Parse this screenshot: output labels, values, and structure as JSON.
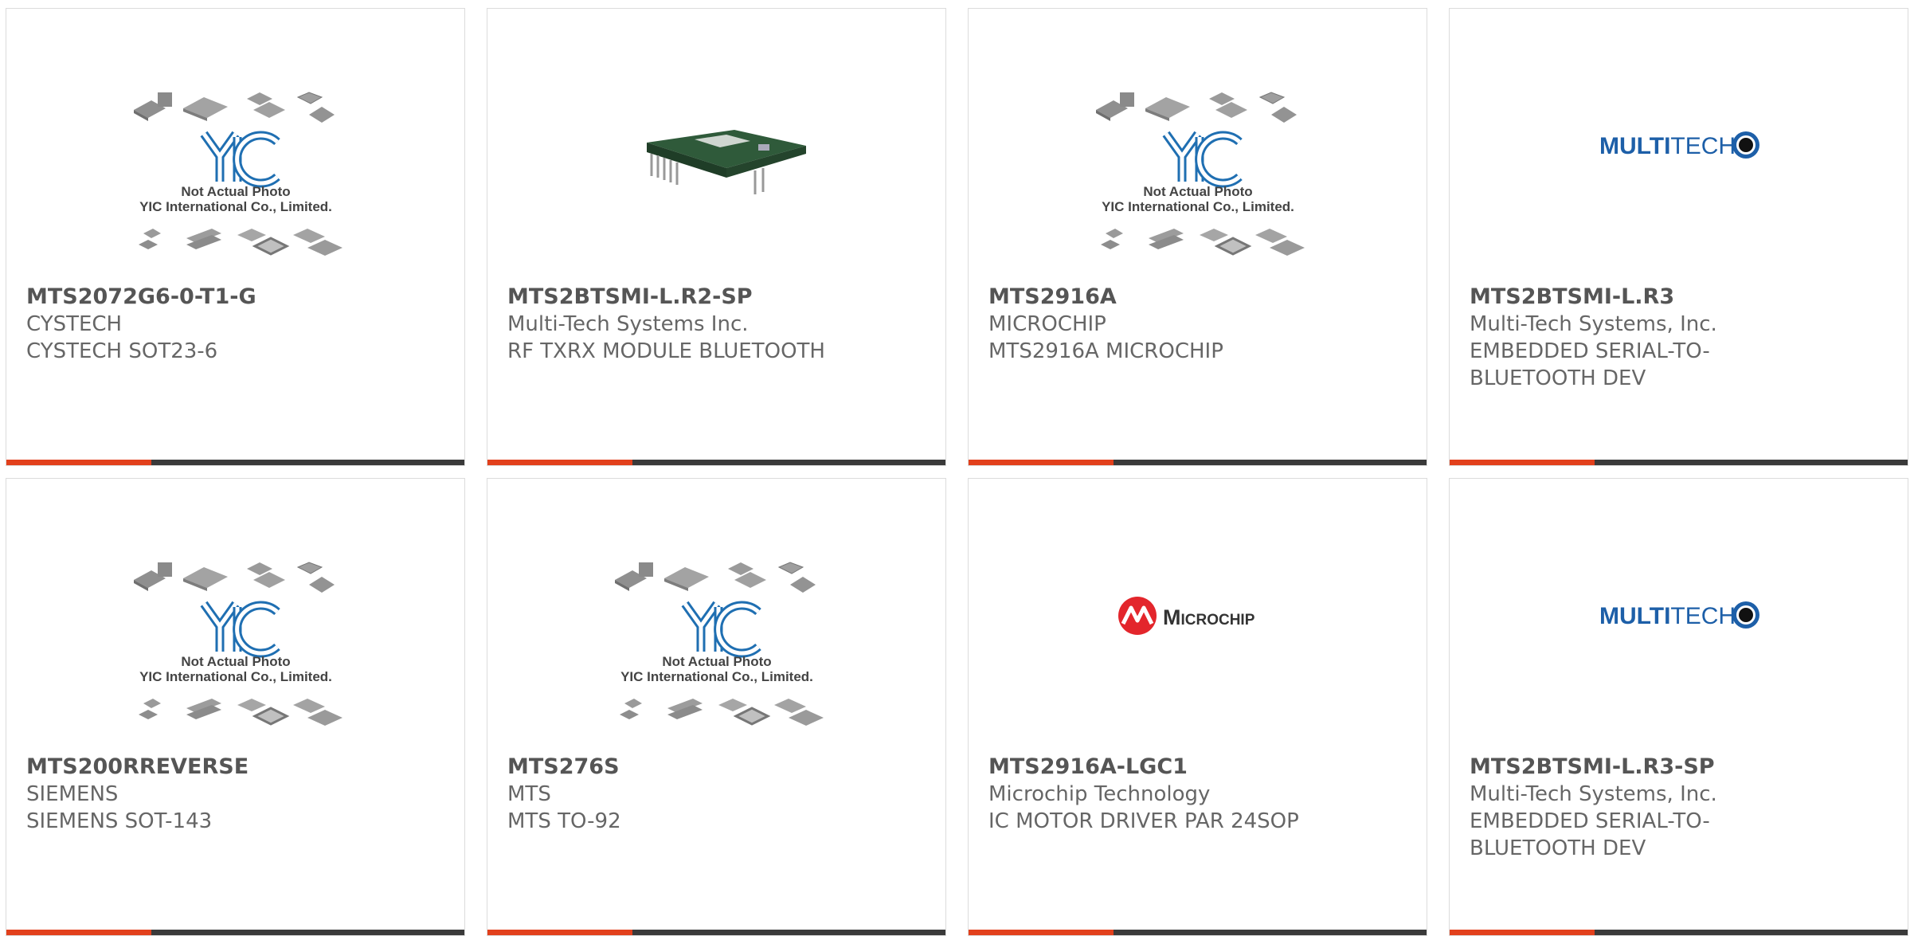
{
  "placeholder": {
    "line1": "Not Actual Photo",
    "line2": "YIC International Co., Limited.",
    "logo_text": "YIC"
  },
  "logos": {
    "multitech": {
      "bold": "MULTI",
      "light": "TECH"
    },
    "microchip": {
      "text": "Microchip"
    }
  },
  "colors": {
    "accent": "#e2401c",
    "bar": "#3a3a3a",
    "yic_blue": "#1f6fb2",
    "multitech_blue": "#1d5fa8",
    "microchip_red": "#e3262c"
  },
  "cards": [
    {
      "part": "MTS2072G6-0-T1-G",
      "manufacturer": "CYSTECH",
      "description": "CYSTECH SOT23-6",
      "image": "placeholder"
    },
    {
      "part": "MTS2BTSMI-L.R2-SP",
      "manufacturer": "Multi-Tech Systems Inc.",
      "description": "RF TXRX MODULE BLUETOOTH",
      "image": "pcb-module"
    },
    {
      "part": "MTS2916A",
      "manufacturer": "MICROCHIP",
      "description": "MTS2916A MICROCHIP",
      "image": "placeholder"
    },
    {
      "part": "MTS2BTSMI-L.R3",
      "manufacturer": "Multi-Tech Systems, Inc.",
      "description": "EMBEDDED SERIAL-TO-BLUETOOTH DEV",
      "image": "multitech-logo"
    },
    {
      "part": "MTS200RREVERSE",
      "manufacturer": "SIEMENS",
      "description": "SIEMENS SOT-143",
      "image": "placeholder"
    },
    {
      "part": "MTS276S",
      "manufacturer": "MTS",
      "description": "MTS TO-92",
      "image": "placeholder"
    },
    {
      "part": "MTS2916A-LGC1",
      "manufacturer": "Microchip Technology",
      "description": "IC MOTOR DRIVER PAR 24SOP",
      "image": "microchip-logo"
    },
    {
      "part": "MTS2BTSMI-L.R3-SP",
      "manufacturer": "Multi-Tech Systems, Inc.",
      "description": "EMBEDDED SERIAL-TO-BLUETOOTH DEV",
      "image": "multitech-logo"
    }
  ]
}
